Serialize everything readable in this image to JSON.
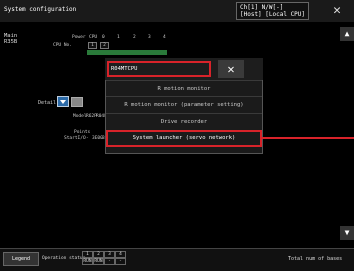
{
  "window": {
    "title": "System configuration",
    "ch_info_line1": "Ch[1]  N/W[-]",
    "ch_info_line2": "[Host]  [Local CPU]",
    "close": "✕"
  },
  "scroll": {
    "up": "▲",
    "down": "▼"
  },
  "main": {
    "base_label_1": "Main",
    "base_label_2": "R35B",
    "cpu_no_label": "CPU No.",
    "power_label": "Power",
    "cpu_label": "CPU",
    "slot_headers": [
      "0",
      "1",
      "2",
      "3",
      "4"
    ],
    "cpu_numbers": [
      "1",
      "2"
    ],
    "detail_label": "Detail",
    "model_label": "Model",
    "model_values": [
      "R62P",
      "R04F",
      "R"
    ],
    "points_label": "Points",
    "start_io_label": "StartI/O",
    "start_io_values": [
      "-",
      "3E00",
      "3E"
    ]
  },
  "popup": {
    "title": "R04MTCPU",
    "close": "✕",
    "items": [
      "R motion monitor",
      "R motion monitor (parameter setting)",
      "Drive recorder",
      "System launcher (servo network)"
    ]
  },
  "bottom": {
    "legend": "Legend",
    "operation_status": "Operation status",
    "status_headers": [
      "1",
      "2",
      "3",
      "4"
    ],
    "status_values": [
      "RUN",
      "RUN",
      "-",
      "-"
    ],
    "total": "Total num of bases"
  }
}
